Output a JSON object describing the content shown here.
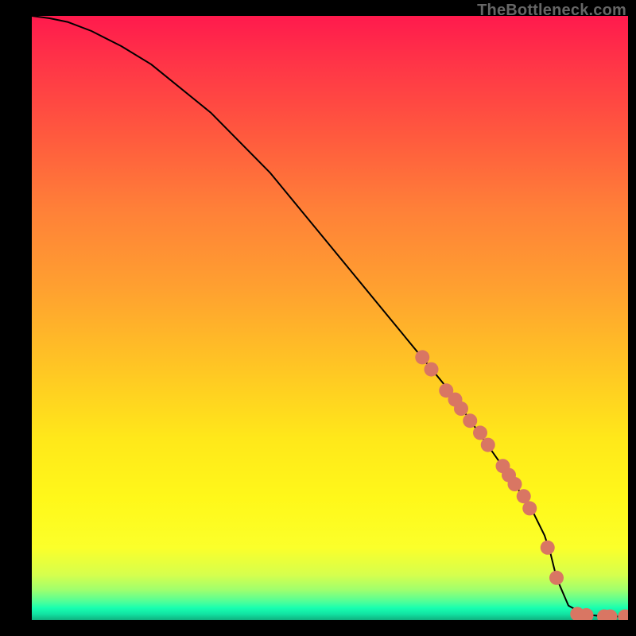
{
  "attribution": "TheBottleneck.com",
  "chart_data": {
    "type": "line",
    "title": "",
    "xlabel": "",
    "ylabel": "",
    "xlim": [
      0,
      100
    ],
    "ylim": [
      0,
      100
    ],
    "series": [
      {
        "name": "curve",
        "x": [
          0,
          3,
          6,
          10,
          15,
          20,
          30,
          40,
          50,
          60,
          65,
          70,
          75,
          80,
          84,
          86,
          87,
          88,
          90,
          92,
          94,
          96,
          100
        ],
        "y": [
          100,
          99.6,
          99,
          97.5,
          95,
          92,
          84,
          74,
          62,
          50,
          44,
          38,
          31,
          24,
          18,
          14,
          11,
          7,
          2.4,
          1.3,
          0.8,
          0.6,
          0.6
        ]
      }
    ],
    "markers": [
      {
        "name": "dots",
        "color": "#d97663",
        "points": [
          {
            "x": 65.5,
            "y": 43.5
          },
          {
            "x": 67.0,
            "y": 41.5
          },
          {
            "x": 69.5,
            "y": 38.0
          },
          {
            "x": 71.0,
            "y": 36.5
          },
          {
            "x": 72.0,
            "y": 35.0
          },
          {
            "x": 73.5,
            "y": 33.0
          },
          {
            "x": 75.2,
            "y": 31.0
          },
          {
            "x": 76.5,
            "y": 29.0
          },
          {
            "x": 79.0,
            "y": 25.5
          },
          {
            "x": 80.0,
            "y": 24.0
          },
          {
            "x": 81.0,
            "y": 22.5
          },
          {
            "x": 82.5,
            "y": 20.5
          },
          {
            "x": 83.5,
            "y": 18.5
          },
          {
            "x": 86.5,
            "y": 12.0
          },
          {
            "x": 88.0,
            "y": 7.0
          },
          {
            "x": 91.5,
            "y": 1.0
          },
          {
            "x": 93.0,
            "y": 0.8
          },
          {
            "x": 96.0,
            "y": 0.6
          },
          {
            "x": 97.0,
            "y": 0.6
          },
          {
            "x": 99.5,
            "y": 0.6
          },
          {
            "x": 100.5,
            "y": 0.6
          }
        ]
      }
    ]
  }
}
